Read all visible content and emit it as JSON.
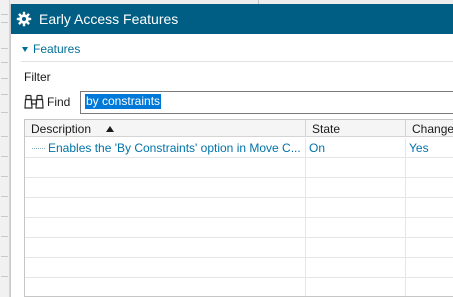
{
  "window": {
    "title": "Early Access Features",
    "title_icon": "gear-icon",
    "colors": {
      "titlebar": "#005d83",
      "accent": "#006e96",
      "link": "#0073a8",
      "selection": "#0078d7"
    }
  },
  "section": {
    "label": "Features",
    "expanded": true
  },
  "filter": {
    "label": "Filter",
    "find_label": "Find",
    "find_icon": "binoculars-icon",
    "value": "by constraints"
  },
  "grid": {
    "columns": [
      "Description",
      "State",
      "Change"
    ],
    "sort": {
      "column": "Description",
      "direction": "ascending"
    },
    "rows": [
      {
        "description": "Enables the 'By Constraints' option in Move C...",
        "state": "On",
        "change": "Yes"
      }
    ]
  }
}
